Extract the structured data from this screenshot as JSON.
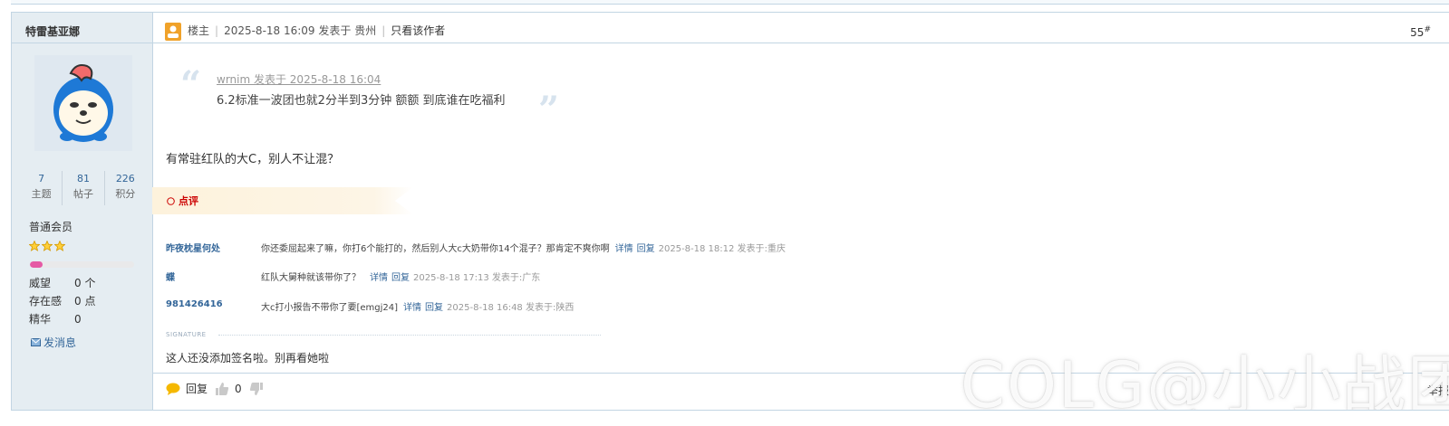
{
  "user": {
    "name": "特雷基亚娜",
    "stats": [
      {
        "value": "7",
        "label": "主题"
      },
      {
        "value": "81",
        "label": "帖子"
      },
      {
        "value": "226",
        "label": "积分"
      }
    ],
    "group": "普通会员",
    "star_count": 3,
    "level_progress": 0.12,
    "attrs": [
      {
        "key": "威望",
        "value": "0 个"
      },
      {
        "key": "存在感",
        "value": "0 点"
      },
      {
        "key": "精华",
        "value": "0"
      }
    ],
    "send_message": "发消息"
  },
  "post": {
    "op_label": "楼主",
    "time": "2025-8-18 16:09 发表于 贵州",
    "author_only": "只看该作者",
    "floor": "55",
    "floor_mark": "#",
    "quote": {
      "header": "wrnim 发表于 2025-8-18 16:04",
      "body": "6.2标准一波团也就2分半到3分钟  额额 到底谁在吃福利"
    },
    "content": "有常驻红队的大C，别人不让混？",
    "comment_title": "点评",
    "comments": [
      {
        "who": "昨夜枕星何处",
        "text": "你还委屈起来了嘛，你打6个能打的，然后别人大c大奶带你14个混子？那肯定不爽你啊",
        "detail": "详情",
        "reply": "回复",
        "time": "2025-8-18 18:12 发表于:重庆"
      },
      {
        "who": "蝶",
        "text": "红队大舅种就该带你了？",
        "detail": "详情",
        "reply": "回复",
        "time": "2025-8-18 17:13 发表于:广东"
      },
      {
        "who": "981426416",
        "text": "大c打小报告不带你了要[emgj24]",
        "detail": "详情",
        "reply": "回复",
        "time": "2025-8-18 16:48 发表于:陕西"
      }
    ],
    "signature_label": "SIGNATURE",
    "signature": "这人还没添加签名啦。别再看她啦",
    "reply_label": "回复",
    "like_count": "0",
    "report_label": "举报"
  },
  "watermark": "COLG@小小战团"
}
